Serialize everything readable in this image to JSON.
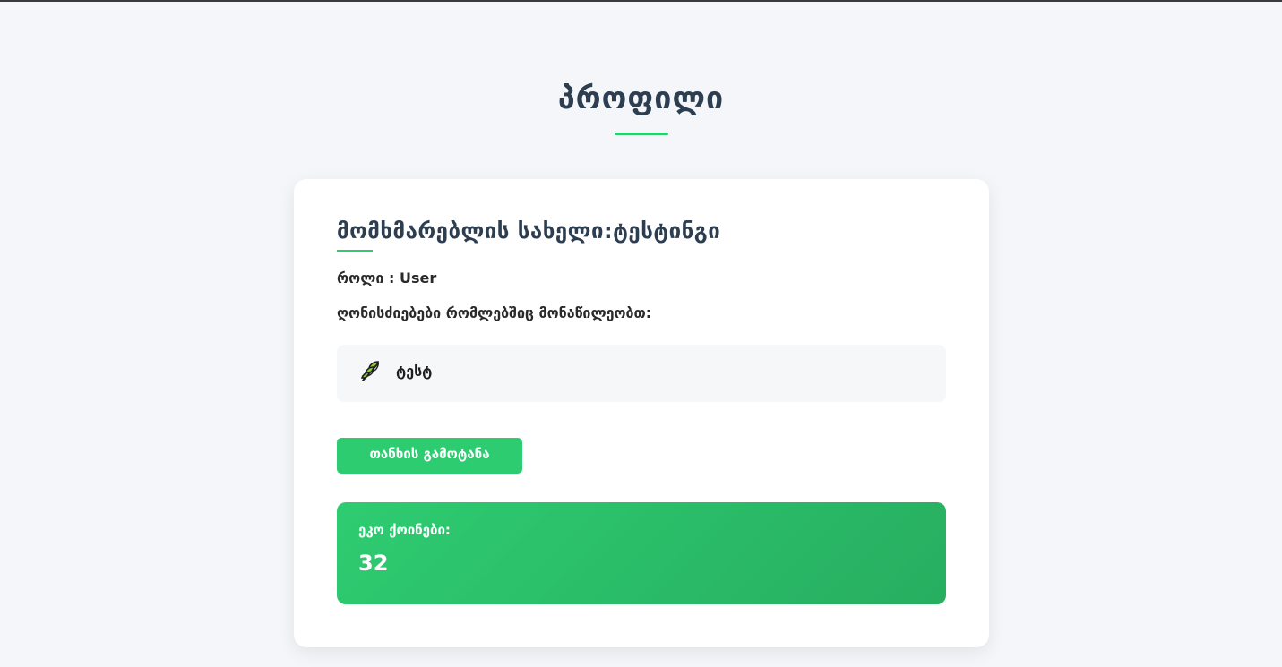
{
  "page": {
    "title": "პროფილი"
  },
  "profile": {
    "username_text": "მომხმარებლის სახელი:ტესტინგი",
    "role_text": "როლი : User",
    "events_heading": "ღონისძიებები რომლებშიც მონაწილეობთ:",
    "events": [
      {
        "label": "ტესტ",
        "icon": "leaf-icon"
      }
    ],
    "leave_button_label": "თანხის გამოტანა",
    "eco_points_label": "ეკო ქოინები:",
    "eco_points_value": "32"
  },
  "colors": {
    "accent": "#2ecc71",
    "accent_dark": "#27ae60",
    "heading": "#2c3e50",
    "background": "#f4f6f9"
  }
}
